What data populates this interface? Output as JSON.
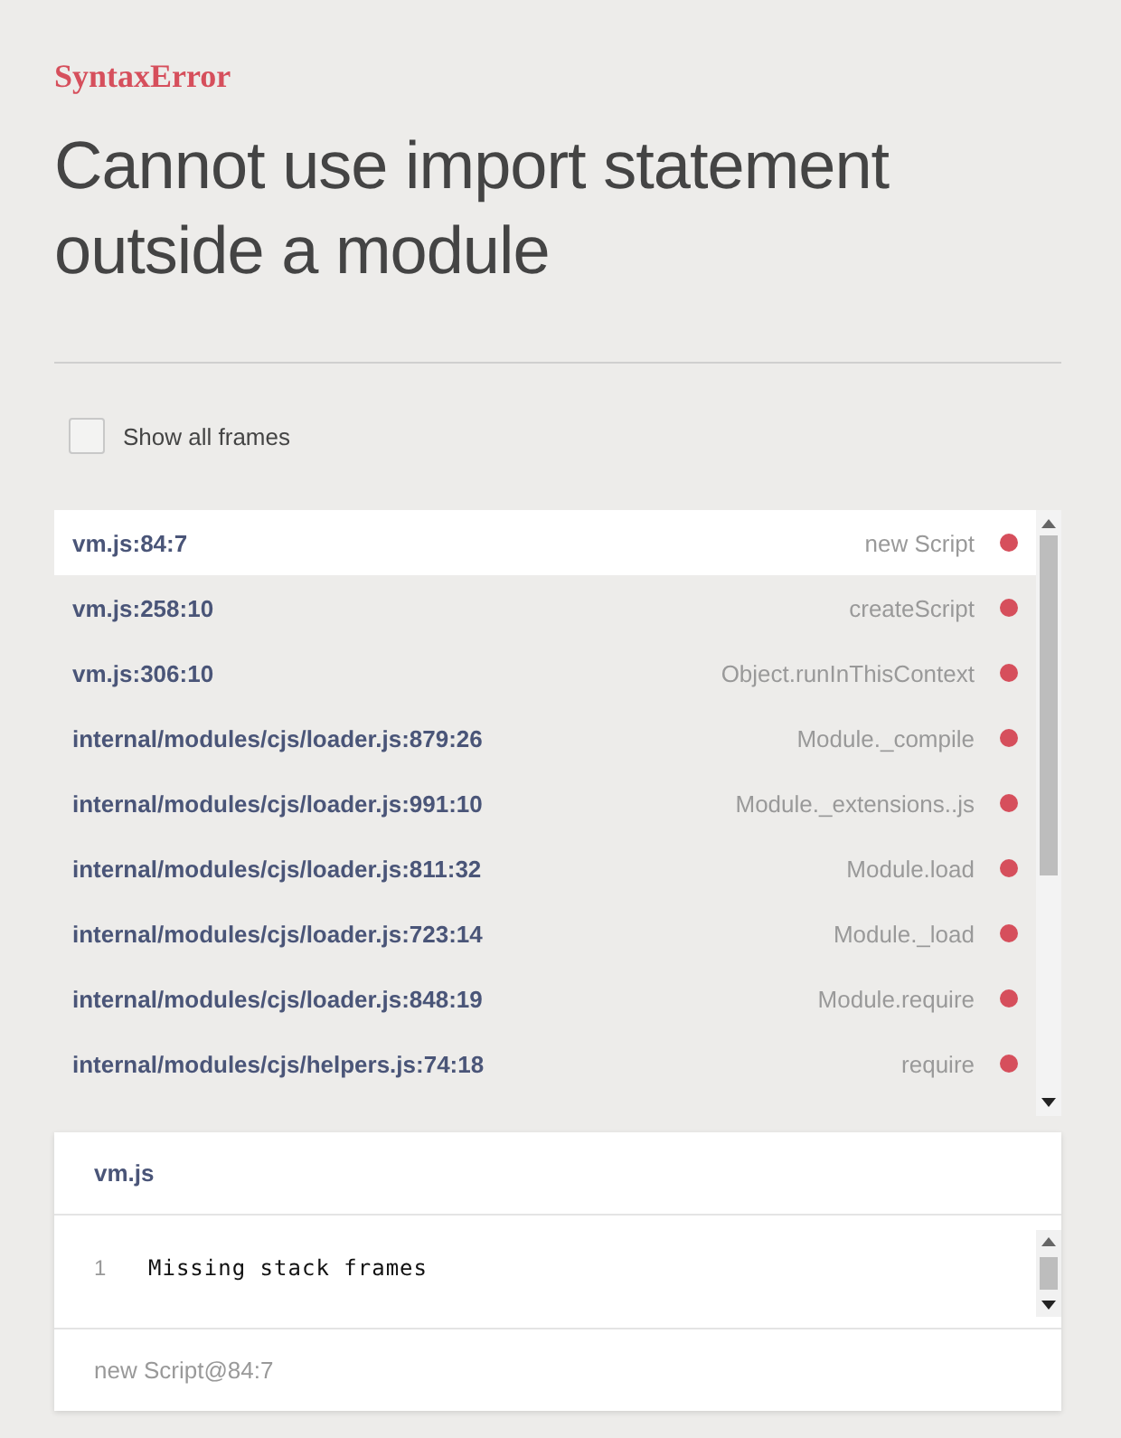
{
  "error": {
    "type": "SyntaxError",
    "message": "Cannot use import statement outside a module"
  },
  "show_all_frames": {
    "label": "Show all frames",
    "checked": false
  },
  "frames": [
    {
      "file": "vm.js:84:7",
      "function": "new Script",
      "selected": true
    },
    {
      "file": "vm.js:258:10",
      "function": "createScript",
      "selected": false
    },
    {
      "file": "vm.js:306:10",
      "function": "Object.runInThisContext",
      "selected": false
    },
    {
      "file": "internal/modules/cjs/loader.js:879:26",
      "function": "Module._compile",
      "selected": false
    },
    {
      "file": "internal/modules/cjs/loader.js:991:10",
      "function": "Module._extensions..js",
      "selected": false
    },
    {
      "file": "internal/modules/cjs/loader.js:811:32",
      "function": "Module.load",
      "selected": false
    },
    {
      "file": "internal/modules/cjs/loader.js:723:14",
      "function": "Module._load",
      "selected": false
    },
    {
      "file": "internal/modules/cjs/loader.js:848:19",
      "function": "Module.require",
      "selected": false
    },
    {
      "file": "internal/modules/cjs/helpers.js:74:18",
      "function": "require",
      "selected": false
    }
  ],
  "code_panel": {
    "file": "vm.js",
    "lines": [
      {
        "number": "1",
        "text": "Missing stack frames"
      }
    ],
    "footer": "new Script@84:7"
  }
}
